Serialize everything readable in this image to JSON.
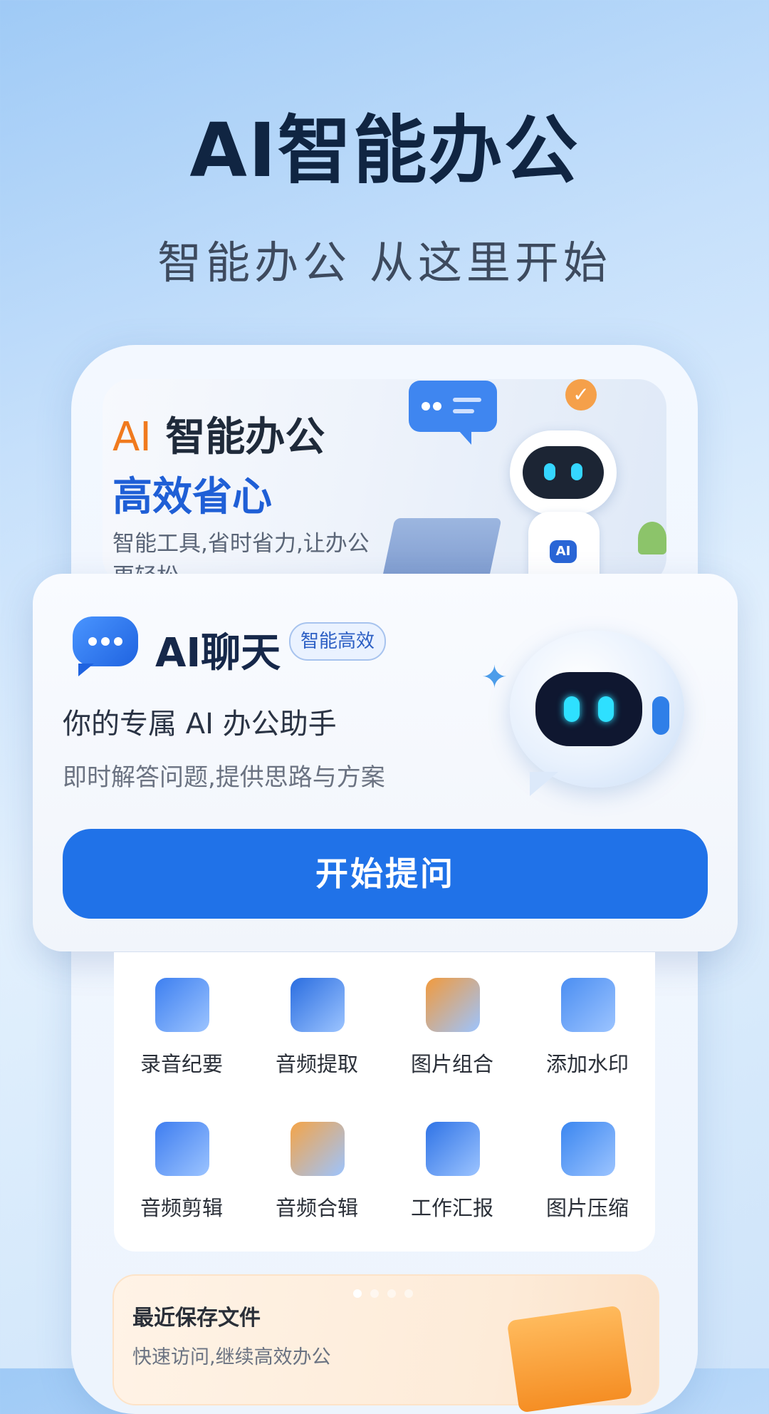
{
  "hero": {
    "title": "AI智能办公",
    "subtitle": "智能办公 从这里开始"
  },
  "banner": {
    "ai_prefix": "AI",
    "line1_text": " 智能办公",
    "line2": "高效省心",
    "line3": "智能工具,省时省力,让办公更轻松",
    "robot_badge": "AI"
  },
  "ai_chat_card": {
    "title": "AI聊天",
    "tag": "智能高效",
    "desc_primary": "你的专属 AI 办公助手",
    "desc_secondary": "即时解答问题,提供思路与方案",
    "button_label": "开始提问"
  },
  "tools": [
    {
      "label": "录音纪要",
      "icon": "recording-notes-icon",
      "color": "#3d7ff0"
    },
    {
      "label": "音频提取",
      "icon": "audio-extract-icon",
      "color": "#2a6de0"
    },
    {
      "label": "图片组合",
      "icon": "image-combine-icon",
      "color": "#f29a3c"
    },
    {
      "label": "添加水印",
      "icon": "watermark-icon",
      "color": "#4b8ef2"
    },
    {
      "label": "音频剪辑",
      "icon": "audio-cut-icon",
      "color": "#3e7df0"
    },
    {
      "label": "音频合辑",
      "icon": "audio-merge-icon",
      "color": "#f5a447"
    },
    {
      "label": "工作汇报",
      "icon": "work-report-icon",
      "color": "#2f73e6"
    },
    {
      "label": "图片压缩",
      "icon": "image-compress-icon",
      "color": "#3a86f0"
    }
  ],
  "pager": {
    "count": 4,
    "active": 0
  },
  "recent": {
    "title": "最近保存文件",
    "subtitle": "快速访问,继续高效办公"
  },
  "colors": {
    "accent": "#2072e8",
    "orange": "#f07a1e",
    "title_dark": "#102542"
  }
}
